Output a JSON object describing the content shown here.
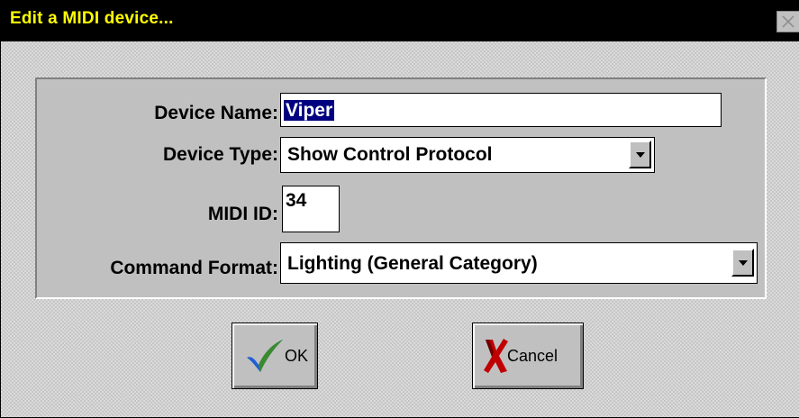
{
  "window": {
    "title": "Edit a MIDI device...",
    "close_symbol": "×"
  },
  "form": {
    "device_name": {
      "label": "Device Name:",
      "value": "Viper"
    },
    "device_type": {
      "label": "Device Type:",
      "value": "Show Control Protocol"
    },
    "midi_id": {
      "label": "MIDI ID:",
      "value": "34"
    },
    "command_format": {
      "label": "Command Format:",
      "value": "Lighting (General Category)"
    }
  },
  "buttons": {
    "ok": {
      "label": "OK",
      "icon": "checkmark-icon"
    },
    "cancel": {
      "label": "Cancel",
      "icon": "x-cross-icon"
    }
  },
  "colors": {
    "titlebar_bg": "#000000",
    "title_text": "#ffff00",
    "selection_bg": "#000080",
    "ok_check": "#1f5fd6",
    "cancel_x": "#c00000"
  }
}
